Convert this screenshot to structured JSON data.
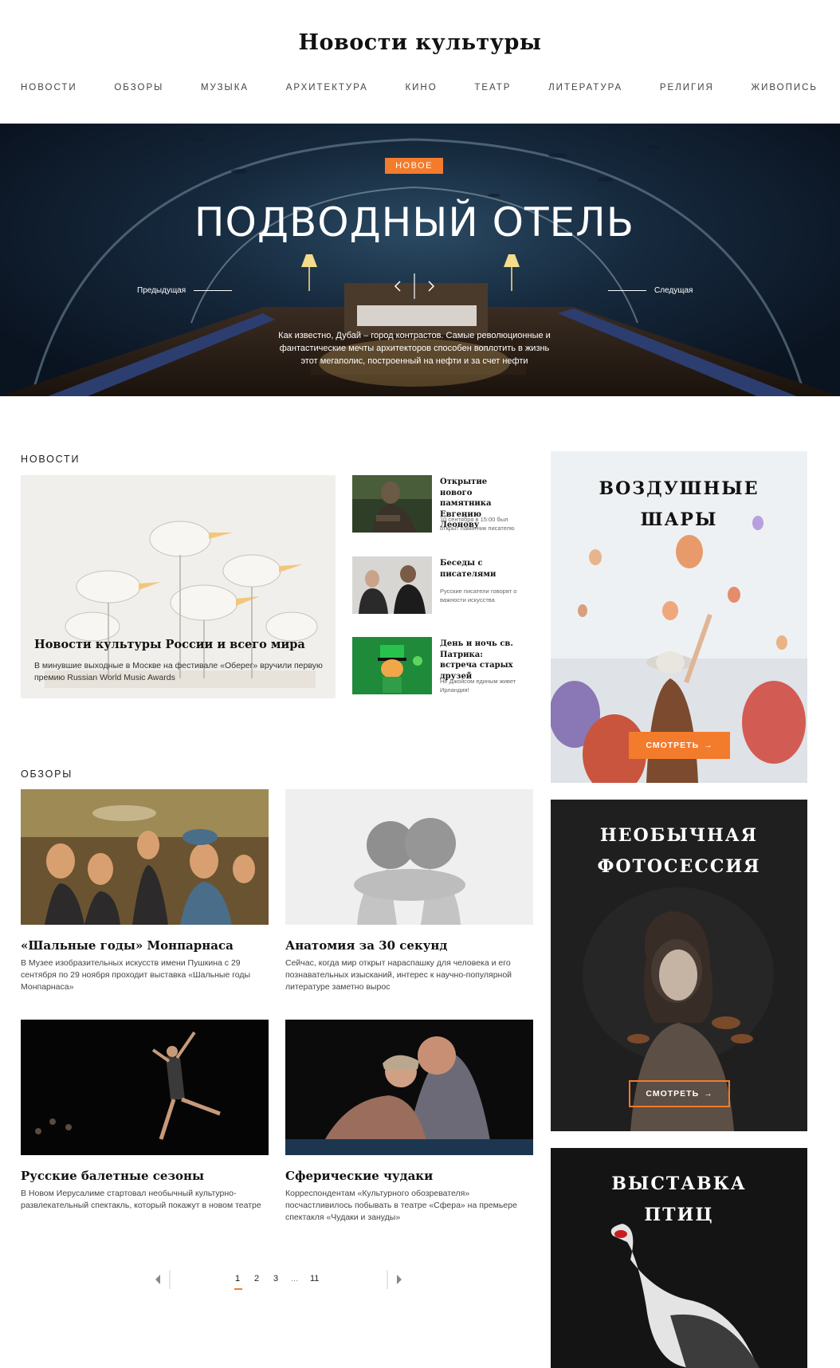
{
  "site": {
    "title": "Новости культуры"
  },
  "nav": [
    "НОВОСТИ",
    "ОБЗОРЫ",
    "МУЗЫКА",
    "АРХИТЕКТУРА",
    "КИНО",
    "ТЕАТР",
    "ЛИТЕРАТУРА",
    "РЕЛИГИЯ",
    "ЖИВОПИСЬ"
  ],
  "hero": {
    "badge": "НОВОЕ",
    "title": "ПОДВОДНЫЙ ОТЕЛЬ",
    "prev": "Предыдущая",
    "next": "Следущая",
    "description": "Как известно, Дубай – город контрастов. Самые революционные и фантастические мечты архитекторов способен воплотить в жизнь этот мегаполис, построенный на нефти и за счет нефти"
  },
  "news": {
    "label": "НОВОСТИ",
    "main": {
      "title": "Новости культуры России и всего мира",
      "text": "В минувшие выходные в Москве на фестивале «Оберег» вручили первую премию Russian World Music Awards"
    },
    "items": [
      {
        "title": "Открытие нового памятника Евгению Леонову",
        "text": "10 сентября в 15:00 был открыт памятник писателю"
      },
      {
        "title": "Беседы с писателями",
        "text": "Русские писатели говорят о важности искусства"
      },
      {
        "title": "День и ночь св. Патрика: встреча старых друзей",
        "text": "Не Джойсом единым живет Ирландия!"
      }
    ]
  },
  "reviews": {
    "label": "ОБЗОРЫ",
    "items": [
      {
        "title": "«Шальные годы» Монпарнаса",
        "text": "В Музее изобразительных искусств имени Пушкина с 29 сентября по 29 ноября проходит выставка «Шальные годы Монпарнаса»"
      },
      {
        "title": "Анатомия за 30 секунд",
        "text": "Сейчас, когда мир открыт нараспашку для человека и его познавательных изысканий, интерес к научно-популярной литературе заметно вырос"
      },
      {
        "title": "Русские балетные сезоны",
        "text": "В Новом Иерусалиме стартовал необычный культурно-развлекательный спектакль, который покажут в новом театре"
      },
      {
        "title": "Сферические чудаки",
        "text": "Корреспондентам «Культурного обозревателя» посчастливилось побывать в театре «Сфера» на премьере спектакля «Чудаки и зануды»"
      }
    ]
  },
  "side": [
    {
      "title_line1": "ВОЗДУШНЫЕ",
      "title_line2": "ШАРЫ",
      "button": "СМОТРЕТЬ"
    },
    {
      "title_line1": "НЕОБЫЧНАЯ",
      "title_line2": "ФОТОСЕССИЯ",
      "button": "СМОТРЕТЬ"
    },
    {
      "title_line1": "ВЫСТАВКА",
      "title_line2": "ПТИЦ"
    }
  ],
  "pager": {
    "pages": [
      "1",
      "2",
      "3",
      "...",
      "11"
    ],
    "current": "1"
  },
  "colors": {
    "accent": "#f37b2c",
    "text": "#222222"
  }
}
